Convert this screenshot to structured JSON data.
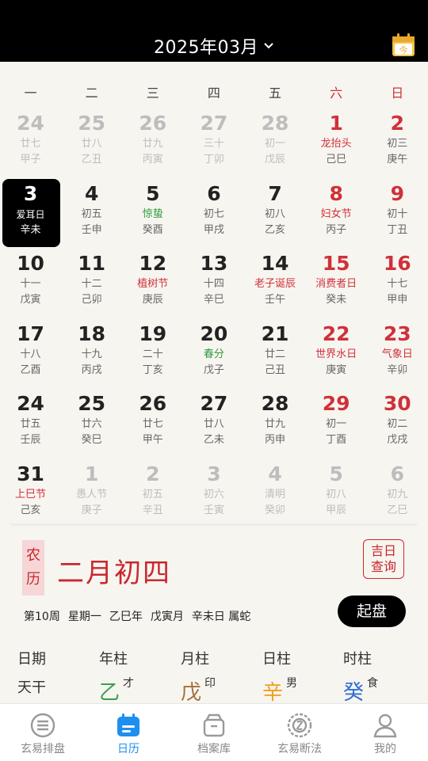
{
  "header": {
    "month_title": "2025年03月",
    "today_label": "今"
  },
  "weekdays": [
    "一",
    "二",
    "三",
    "四",
    "五",
    "六",
    "日"
  ],
  "weeks": [
    [
      {
        "day": "24",
        "lunar": "廿七",
        "gz": "甲子",
        "other": true
      },
      {
        "day": "25",
        "lunar": "廿八",
        "gz": "乙丑",
        "other": true
      },
      {
        "day": "26",
        "lunar": "廿九",
        "gz": "丙寅",
        "other": true
      },
      {
        "day": "27",
        "lunar": "三十",
        "gz": "丁卯",
        "other": true
      },
      {
        "day": "28",
        "lunar": "初一",
        "gz": "戊辰",
        "other": true
      },
      {
        "day": "1",
        "lunar": "龙抬头",
        "gz": "己巳",
        "lunar_color": "red"
      },
      {
        "day": "2",
        "lunar": "初三",
        "gz": "庚午"
      }
    ],
    [
      {
        "day": "3",
        "lunar": "爱耳日",
        "gz": "辛未",
        "selected": true
      },
      {
        "day": "4",
        "lunar": "初五",
        "gz": "壬申"
      },
      {
        "day": "5",
        "lunar": "惊蛰",
        "gz": "癸酉",
        "lunar_color": "green"
      },
      {
        "day": "6",
        "lunar": "初七",
        "gz": "甲戌"
      },
      {
        "day": "7",
        "lunar": "初八",
        "gz": "乙亥"
      },
      {
        "day": "8",
        "lunar": "妇女节",
        "gz": "丙子",
        "lunar_color": "red"
      },
      {
        "day": "9",
        "lunar": "初十",
        "gz": "丁丑"
      }
    ],
    [
      {
        "day": "10",
        "lunar": "十一",
        "gz": "戊寅"
      },
      {
        "day": "11",
        "lunar": "十二",
        "gz": "己卯"
      },
      {
        "day": "12",
        "lunar": "植树节",
        "gz": "庚辰",
        "lunar_color": "red"
      },
      {
        "day": "13",
        "lunar": "十四",
        "gz": "辛巳"
      },
      {
        "day": "14",
        "lunar": "老子诞辰",
        "gz": "壬午",
        "lunar_color": "red"
      },
      {
        "day": "15",
        "lunar": "消费者日",
        "gz": "癸未",
        "lunar_color": "red"
      },
      {
        "day": "16",
        "lunar": "十七",
        "gz": "甲申"
      }
    ],
    [
      {
        "day": "17",
        "lunar": "十八",
        "gz": "乙酉"
      },
      {
        "day": "18",
        "lunar": "十九",
        "gz": "丙戌"
      },
      {
        "day": "19",
        "lunar": "二十",
        "gz": "丁亥"
      },
      {
        "day": "20",
        "lunar": "春分",
        "gz": "戊子",
        "lunar_color": "green"
      },
      {
        "day": "21",
        "lunar": "廿二",
        "gz": "己丑"
      },
      {
        "day": "22",
        "lunar": "世界水日",
        "gz": "庚寅",
        "lunar_color": "red"
      },
      {
        "day": "23",
        "lunar": "气象日",
        "gz": "辛卯",
        "lunar_color": "red"
      }
    ],
    [
      {
        "day": "24",
        "lunar": "廿五",
        "gz": "壬辰"
      },
      {
        "day": "25",
        "lunar": "廿六",
        "gz": "癸巳"
      },
      {
        "day": "26",
        "lunar": "廿七",
        "gz": "甲午"
      },
      {
        "day": "27",
        "lunar": "廿八",
        "gz": "乙未"
      },
      {
        "day": "28",
        "lunar": "廿九",
        "gz": "丙申"
      },
      {
        "day": "29",
        "lunar": "初一",
        "gz": "丁酉"
      },
      {
        "day": "30",
        "lunar": "初二",
        "gz": "戊戌"
      }
    ],
    [
      {
        "day": "31",
        "lunar": "上巳节",
        "gz": "己亥",
        "lunar_color": "red"
      },
      {
        "day": "1",
        "lunar": "愚人节",
        "gz": "庚子",
        "other": true
      },
      {
        "day": "2",
        "lunar": "初五",
        "gz": "辛丑",
        "other": true
      },
      {
        "day": "3",
        "lunar": "初六",
        "gz": "壬寅",
        "other": true
      },
      {
        "day": "4",
        "lunar": "清明",
        "gz": "癸卯",
        "other": true
      },
      {
        "day": "5",
        "lunar": "初八",
        "gz": "甲辰",
        "other": true
      },
      {
        "day": "6",
        "lunar": "初九",
        "gz": "乙巳",
        "other": true
      }
    ]
  ],
  "lunar_panel": {
    "seal_top": "农",
    "seal_bottom": "历",
    "lunar_date": "二月初四",
    "jiri_line1": "吉日",
    "jiri_line2": "查询",
    "info": [
      "第10周",
      "星期一",
      "乙巳年",
      "戊寅月",
      "辛未日 属蛇"
    ],
    "qipan_label": "起盘"
  },
  "pillars": {
    "headers": [
      "日期",
      "年柱",
      "月柱",
      "日柱",
      "时柱"
    ],
    "row_label": "天干",
    "cells": [
      {
        "char": "乙",
        "tag": "才",
        "color": "#3aa050"
      },
      {
        "char": "戊",
        "tag": "印",
        "color": "#a0703a"
      },
      {
        "char": "辛",
        "tag": "男",
        "color": "#f0a020"
      },
      {
        "char": "癸",
        "tag": "食",
        "color": "#2f6fd6"
      }
    ]
  },
  "nav": [
    {
      "label": "玄易排盘",
      "icon": "menu-icon"
    },
    {
      "label": "日历",
      "icon": "calendar-icon",
      "active": true
    },
    {
      "label": "档案库",
      "icon": "archive-icon"
    },
    {
      "label": "玄易断法",
      "icon": "coin-icon"
    },
    {
      "label": "我的",
      "icon": "person-icon"
    }
  ],
  "colors": {
    "accent": "#1e8ef0",
    "red": "#d0313a",
    "header_bg": "#000000"
  }
}
